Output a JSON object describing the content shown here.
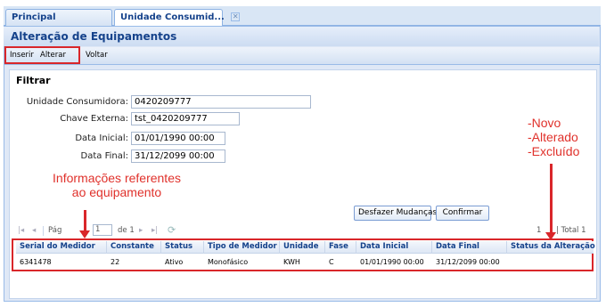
{
  "tabs": [
    {
      "label": "Principal"
    },
    {
      "label": "Unidade Consumid..."
    }
  ],
  "panel": {
    "title": "Alteração de Equipamentos"
  },
  "toolbar": {
    "insert": "Inserir",
    "alter": "Alterar",
    "back": "Voltar"
  },
  "filter": {
    "title": "Filtrar",
    "fields": [
      {
        "label": "Unidade Consumidora:",
        "value": "0420209777"
      },
      {
        "label": "Chave Externa:",
        "value": "tst_0420209777"
      },
      {
        "label": "Data Inicial:",
        "value": "01/01/1990 00:00"
      },
      {
        "label": "Data Final:",
        "value": "31/12/2099 00:00"
      }
    ]
  },
  "annotations": {
    "info_line1": "Informações referentes",
    "info_line2": "ao equipamento",
    "status_list": [
      "-Novo",
      "-Alterado",
      "-Excluído"
    ]
  },
  "buttons": {
    "undo": "Desfazer Mudanças",
    "confirm": "Confirmar"
  },
  "pager": {
    "page_label": "Pág",
    "page_value": "1",
    "of_label": "de 1",
    "total_prefix": "1",
    "total_label": "| Total 1"
  },
  "grid": {
    "columns": [
      "Serial do Medidor",
      "Constante",
      "Status",
      "Tipo de Medidor",
      "Unidade",
      "Fase",
      "Data Inicial",
      "Data Final",
      "Status da Alteração"
    ],
    "rows": [
      [
        "6341478",
        "22",
        "Ativo",
        "Monofásico",
        "KWH",
        "C",
        "01/01/1990 00:00",
        "31/12/2099 00:00",
        ""
      ]
    ]
  },
  "colors": {
    "accent": "#15428b",
    "annotation": "#e0312b",
    "panel_bg": "#dfe8f6"
  }
}
